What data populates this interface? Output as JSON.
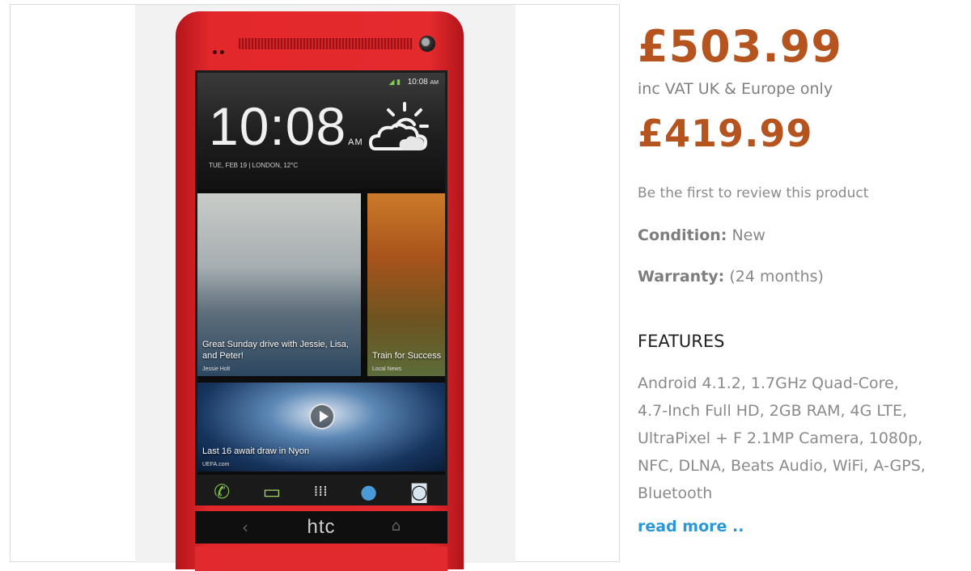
{
  "product": {
    "price_inc_vat": "£503.99",
    "price_note": "inc VAT UK & Europe only",
    "price_ex_vat": "£419.99",
    "review_prompt": "Be the first to review this product",
    "condition_label": "Condition:",
    "condition_value": "New",
    "warranty_label": "Warranty:",
    "warranty_value": "(24 months)",
    "features_heading": "FEATURES",
    "features_text": "Android 4.1.2, 1.7GHz Quad-Core,\n4.7-Inch Full HD, 2GB RAM, 4G LTE,\nUltraPixel + F 2.1MP Camera, 1080p,\nNFC, DLNA, Beats Audio, WiFi, A-GPS,\nBluetooth",
    "read_more": "read more .."
  },
  "phone_screen": {
    "status_time": "10:08",
    "status_ampm": "AM",
    "clock_time": "10:08",
    "clock_ampm": "AM",
    "date_line": "TUE, FEB 19 | LONDON, 12°C",
    "tile_friends_caption": "Great Sunday drive with Jessie, Lisa, and Peter!",
    "tile_friends_source": "Jessie Holt",
    "tile_sport_caption": "Train for Success",
    "tile_sport_source": "Local News",
    "tile_news_caption": "Last 16 await draw in Nyon",
    "tile_news_source": "UEFA.com",
    "brand": "htc"
  },
  "colors": {
    "price": "#b5541e",
    "link": "#2b97d6",
    "phone_body": "#e52a2e"
  },
  "icons": [
    "wifi-icon",
    "signal-icon",
    "battery-icon",
    "weather-icon",
    "play-icon",
    "phone-icon",
    "messages-icon",
    "apps-icon",
    "browser-icon",
    "camera-icon",
    "back-icon",
    "home-icon"
  ]
}
